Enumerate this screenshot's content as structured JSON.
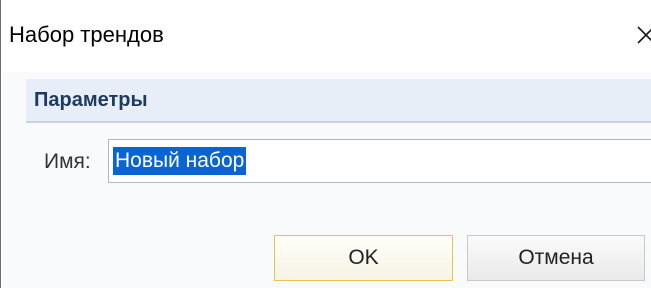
{
  "window": {
    "title": "Набор трендов"
  },
  "group": {
    "title": "Параметры"
  },
  "form": {
    "name_label": "Имя:",
    "name_value": "Новый набор"
  },
  "buttons": {
    "ok_label": "OK",
    "cancel_label": "Отмена"
  },
  "colors": {
    "selection": "#0a64d2",
    "group_header_bg": "#e8eef7",
    "ok_border": "#e7c34a"
  },
  "icons": {
    "close": "close-icon"
  }
}
